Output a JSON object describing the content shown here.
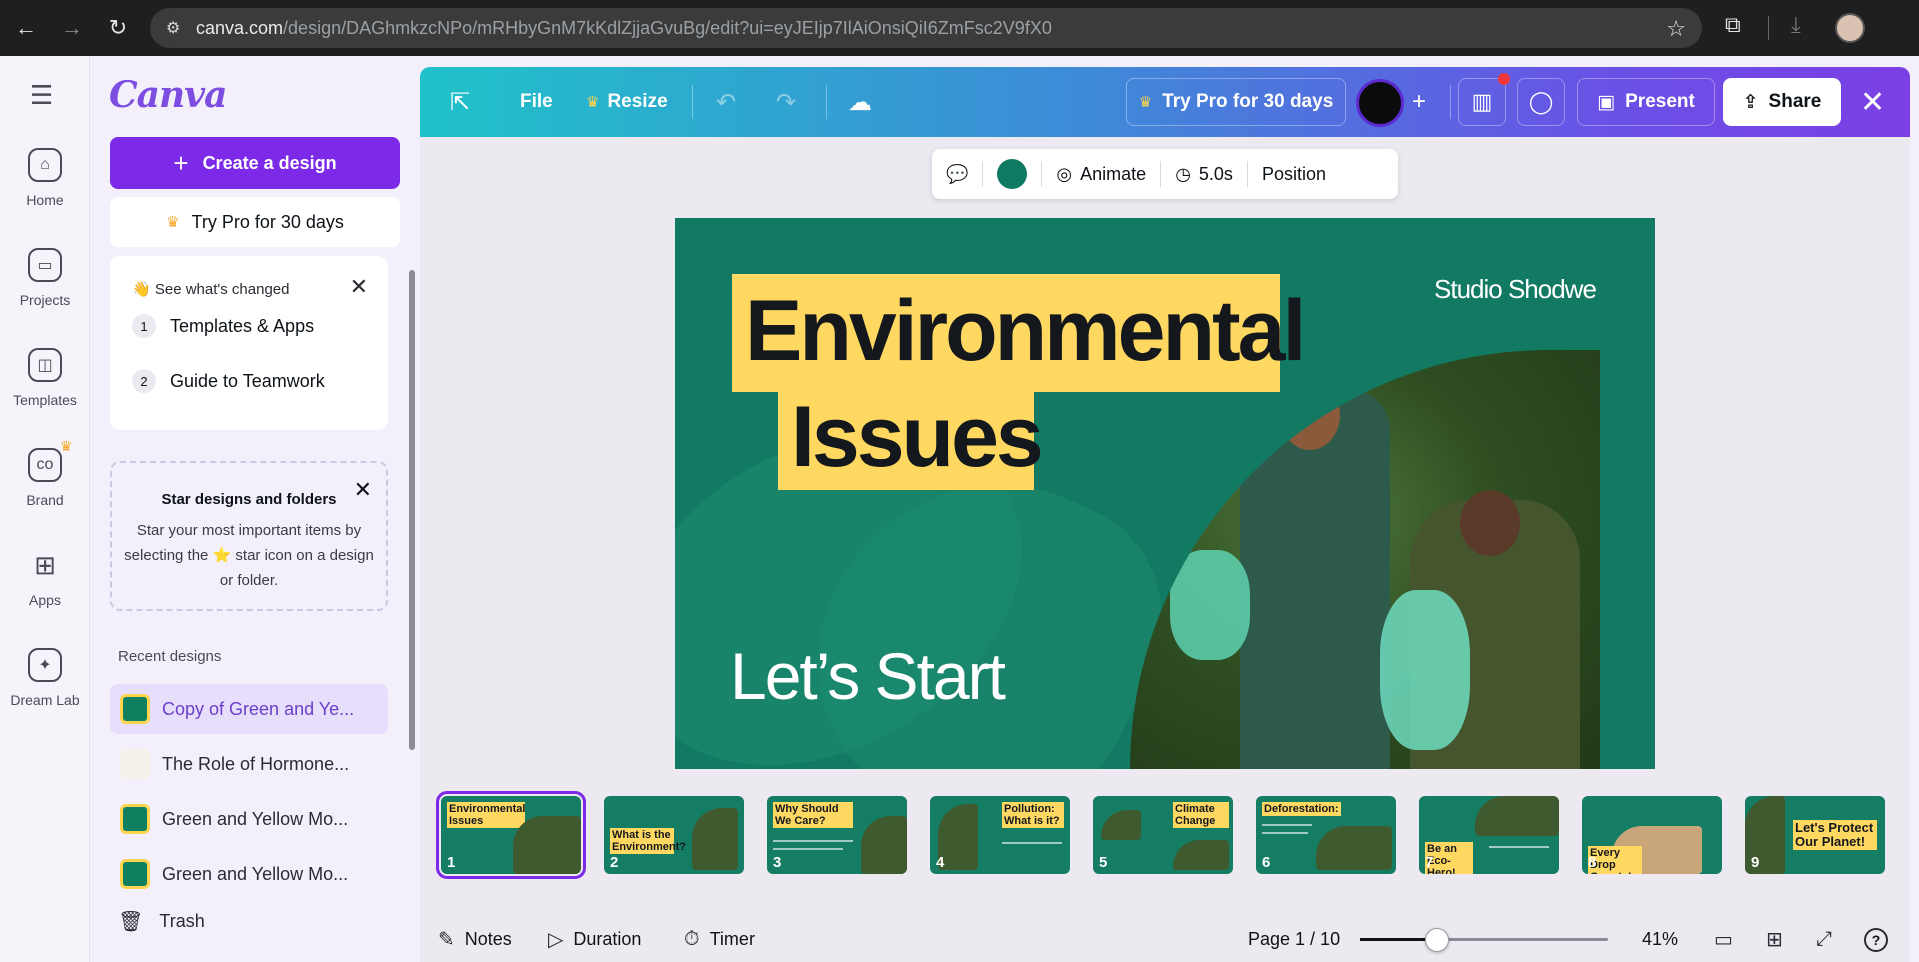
{
  "browser": {
    "url_host": "canva.com",
    "url_path": "/design/DAGhmkzcNPo/mRHbyGnM7kKdlZjjaGvuBg/edit?ui=eyJEIjp7IlAiOnsiQiI6ZmFsc2V9fX0"
  },
  "rail": {
    "items": [
      {
        "label": "Home",
        "icon": "home-icon"
      },
      {
        "label": "Projects",
        "icon": "folder-icon"
      },
      {
        "label": "Templates",
        "icon": "templates-icon"
      },
      {
        "label": "Brand",
        "icon": "brand-icon"
      },
      {
        "label": "Apps",
        "icon": "apps-icon"
      },
      {
        "label": "Dream Lab",
        "icon": "dream-lab-icon"
      }
    ]
  },
  "panel": {
    "logo": "Canva",
    "create_label": "Create a design",
    "try_pro_label": "Try Pro for 30 days",
    "changed": {
      "header": "👋 See what's changed",
      "items": [
        {
          "num": "1",
          "label": "Templates & Apps"
        },
        {
          "num": "2",
          "label": "Guide to Teamwork"
        }
      ]
    },
    "star": {
      "title": "Star designs and folders",
      "body": "Star your most important items by selecting the ⭐ star icon on a design or folder."
    },
    "recent_title": "Recent designs",
    "recent": [
      {
        "label": "Copy of Green and Ye..."
      },
      {
        "label": "The Role of Hormone..."
      },
      {
        "label": "Green and Yellow Mo..."
      },
      {
        "label": "Green and Yellow Mo..."
      }
    ],
    "trash_label": "Trash"
  },
  "topbar": {
    "file_label": "File",
    "resize_label": "Resize",
    "try_pro_label": "Try Pro for 30 days",
    "present_label": "Present",
    "share_label": "Share"
  },
  "context_toolbar": {
    "animate_label": "Animate",
    "duration_label": "5.0s",
    "position_label": "Position",
    "color": "#0f7a62"
  },
  "slide": {
    "title_line1": "Environmental",
    "title_line2": "Issues",
    "studio": "Studio Shodwe",
    "subtitle": "Let’s Start"
  },
  "filmstrip": [
    {
      "num": "1",
      "title": "Environmental Issues"
    },
    {
      "num": "2",
      "title": "What is the Environment?"
    },
    {
      "num": "3",
      "title": "Why Should We Care?"
    },
    {
      "num": "4",
      "title": "Pollution: What is it?"
    },
    {
      "num": "5",
      "title": "Climate Change"
    },
    {
      "num": "6",
      "title": "Deforestation:"
    },
    {
      "num": "7",
      "title": "Be an Eco-Hero!"
    },
    {
      "num": "8",
      "title": "Every Drop Counts!"
    },
    {
      "num": "9",
      "title": "Let's Protect Our Planet!"
    }
  ],
  "bottombar": {
    "notes_label": "Notes",
    "duration_label": "Duration",
    "timer_label": "Timer",
    "page_label": "Page 1 / 10",
    "zoom_label": "41%",
    "zoom_slider_fraction": 0.31
  },
  "colors": {
    "accent": "#7d2ae8",
    "slide_green": "#127a62",
    "highlight_yellow": "#ffd862"
  }
}
